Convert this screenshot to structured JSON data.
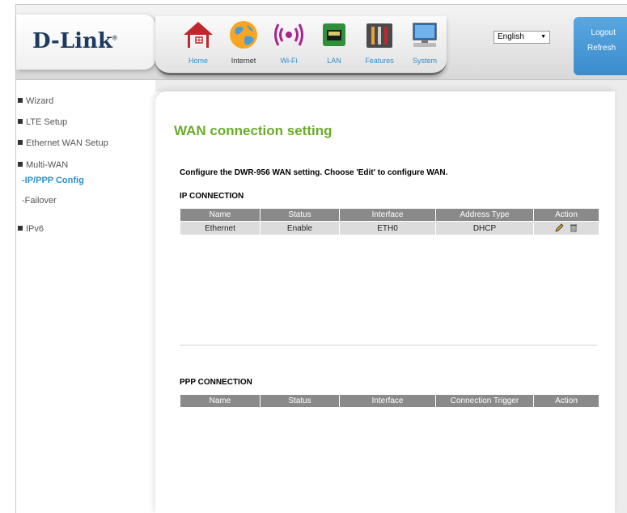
{
  "brand": {
    "logo_text": "D-Link",
    "trademark": "®"
  },
  "nav": {
    "items": [
      {
        "key": "home",
        "label": "Home",
        "icon": "home-icon"
      },
      {
        "key": "internet",
        "label": "Internet",
        "icon": "globe-icon"
      },
      {
        "key": "wifi",
        "label": "Wi-Fi",
        "icon": "wifi-icon"
      },
      {
        "key": "lan",
        "label": "LAN",
        "icon": "lan-icon"
      },
      {
        "key": "features",
        "label": "Features",
        "icon": "tools-icon"
      },
      {
        "key": "system",
        "label": "System",
        "icon": "computer-icon"
      }
    ],
    "active": "internet"
  },
  "language": {
    "selected": "English"
  },
  "account": {
    "logout_label": "Logout",
    "refresh_label": "Refresh"
  },
  "sidebar": {
    "items": [
      {
        "label": "Wizard"
      },
      {
        "label": "LTE Setup"
      },
      {
        "label": "Ethernet WAN Setup"
      },
      {
        "label": "Multi-WAN"
      },
      {
        "label": "IPv6"
      }
    ],
    "sub_items": [
      {
        "label": "-IP/PPP Config",
        "active": true
      },
      {
        "label": "-Failover",
        "active": false
      }
    ]
  },
  "main": {
    "title": "WAN connection setting",
    "description": "Configure the DWR-956 WAN setting. Choose 'Edit' to configure WAN.",
    "ip_section": {
      "title": "IP CONNECTION",
      "headers": [
        "Name",
        "Status",
        "Interface",
        "Address Type",
        "Action"
      ],
      "rows": [
        {
          "name": "Ethernet",
          "status": "Enable",
          "interface": "ETH0",
          "address_type": "DHCP"
        }
      ]
    },
    "ppp_section": {
      "title": "PPP CONNECTION",
      "headers": [
        "Name",
        "Status",
        "Interface",
        "Connection Trigger",
        "Action"
      ]
    }
  },
  "colors": {
    "accent_green": "#6aac2a",
    "accent_blue": "#2b8fd0",
    "table_header": "#8a8a8a",
    "table_row": "#dcdcdc"
  }
}
